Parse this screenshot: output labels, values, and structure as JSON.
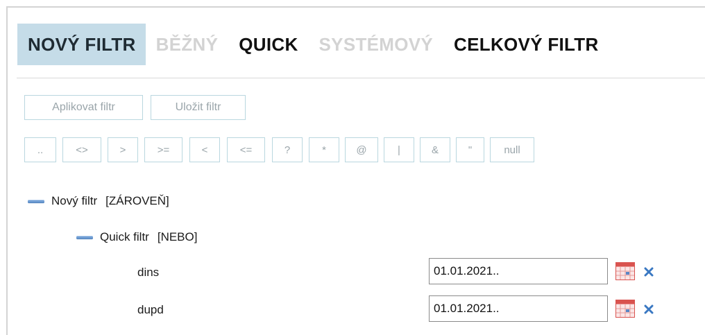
{
  "tabs": [
    {
      "label": "NOVÝ FILTR",
      "state": "active"
    },
    {
      "label": "BĚŽNÝ",
      "state": "disabled"
    },
    {
      "label": "QUICK",
      "state": "normal"
    },
    {
      "label": "SYSTÉMOVÝ",
      "state": "disabled"
    },
    {
      "label": "CELKOVÝ FILTR",
      "state": "normal"
    }
  ],
  "actions": {
    "apply": "Aplikovat filtr",
    "save": "Uložit filtr"
  },
  "operators": [
    "..",
    "<>",
    ">",
    ">=",
    "<",
    "<=",
    "?",
    "*",
    "@",
    "|",
    "&",
    "\"",
    "null"
  ],
  "tree": {
    "root": {
      "name": "Nový filtr",
      "mode": "[ZÁROVEŇ]"
    },
    "child": {
      "name": "Quick filtr",
      "mode": "[NEBO]"
    }
  },
  "fields": [
    {
      "label": "dins",
      "value": "01.01.2021.."
    },
    {
      "label": "dupd",
      "value": "01.01.2021.."
    }
  ],
  "colors": {
    "active_tab_bg": "#c5dce8",
    "border": "#b9d7df",
    "calendar": "#d9534f",
    "remove": "#3a78c2"
  }
}
